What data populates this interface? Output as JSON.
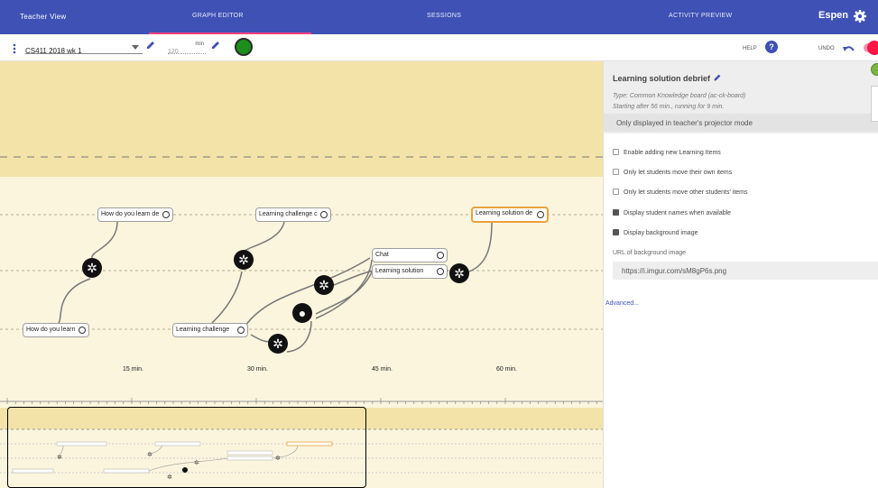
{
  "topbar": {
    "tabs": [
      "Teacher View",
      "GRAPH EDITOR",
      "SESSIONS",
      "ACTIVITY PREVIEW"
    ],
    "user": "Espen",
    "bg": "#3f51b5",
    "indicator": "#ff4081"
  },
  "toolbar": {
    "graph_name": "CS411 2018 wk 1",
    "duration": "120",
    "unit": "min",
    "help_label": "HELP",
    "undo_label": "UNDO",
    "status_color": "#1b8e1b"
  },
  "graph": {
    "nodes": [
      "How do you learn de",
      "Learning challenge c",
      "Learning solution de",
      "Chat",
      "Learning solution",
      "How do you learn",
      "Learning challenge"
    ],
    "ticks": [
      "15 min.",
      "30 min.",
      "45 min.",
      "60 min."
    ],
    "selected_color": "#e8a23d"
  },
  "panel": {
    "title": "Learning solution debrief",
    "type_line": "Type: Common Knowledge board (ac-ck-board)",
    "timing": "Starting after 56 min., running for 9 min.",
    "display_mode": "Only displayed in teacher's projector mode",
    "options": [
      {
        "label": "Enable adding new Learning Items",
        "checked": false
      },
      {
        "label": "Only let students move their own items",
        "checked": false
      },
      {
        "label": "Only let students move other students' items",
        "checked": false
      },
      {
        "label": "Display student names when available",
        "checked": true
      },
      {
        "label": "Display background image",
        "checked": true
      }
    ],
    "bg_url_label": "URL of background image",
    "bg_url_value": "https://i.imgur.com/sM8gP6s.png",
    "advanced_label": "Advanced..."
  }
}
